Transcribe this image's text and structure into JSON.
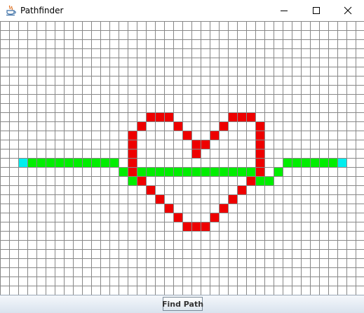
{
  "window": {
    "title": "Pathfinder",
    "icon": "java-cup-icon",
    "controls": [
      "minimize-icon",
      "maximize-icon",
      "close-icon"
    ]
  },
  "grid": {
    "columns": 40,
    "rows": 30,
    "colors": {
      "empty": "#ffffff",
      "line": "#888888",
      "wall": "#ee0000",
      "path": "#00ee00",
      "endpoint": "#00eeee"
    },
    "endpoint_cells": [
      [
        2,
        15
      ],
      [
        37,
        15
      ]
    ],
    "wall_cells": [
      [
        16,
        10
      ],
      [
        17,
        10
      ],
      [
        18,
        10
      ],
      [
        25,
        10
      ],
      [
        26,
        10
      ],
      [
        27,
        10
      ],
      [
        15,
        11
      ],
      [
        19,
        11
      ],
      [
        24,
        11
      ],
      [
        28,
        11
      ],
      [
        14,
        12
      ],
      [
        20,
        12
      ],
      [
        23,
        12
      ],
      [
        28,
        12
      ],
      [
        14,
        13
      ],
      [
        21,
        13
      ],
      [
        22,
        13
      ],
      [
        28,
        13
      ],
      [
        14,
        14
      ],
      [
        21,
        14
      ],
      [
        28,
        14
      ],
      [
        14,
        15
      ],
      [
        28,
        15
      ],
      [
        14,
        16
      ],
      [
        28,
        16
      ],
      [
        15,
        17
      ],
      [
        27,
        17
      ],
      [
        16,
        18
      ],
      [
        26,
        18
      ],
      [
        17,
        19
      ],
      [
        25,
        19
      ],
      [
        18,
        20
      ],
      [
        24,
        20
      ],
      [
        19,
        21
      ],
      [
        23,
        21
      ],
      [
        20,
        22
      ],
      [
        21,
        22
      ],
      [
        22,
        22
      ]
    ],
    "path_cells": [
      [
        3,
        15
      ],
      [
        4,
        15
      ],
      [
        5,
        15
      ],
      [
        6,
        15
      ],
      [
        7,
        15
      ],
      [
        8,
        15
      ],
      [
        9,
        15
      ],
      [
        10,
        15
      ],
      [
        11,
        15
      ],
      [
        12,
        15
      ],
      [
        13,
        16
      ],
      [
        14,
        17
      ],
      [
        15,
        16
      ],
      [
        16,
        16
      ],
      [
        17,
        16
      ],
      [
        18,
        16
      ],
      [
        19,
        16
      ],
      [
        20,
        16
      ],
      [
        21,
        16
      ],
      [
        22,
        16
      ],
      [
        23,
        16
      ],
      [
        24,
        16
      ],
      [
        25,
        16
      ],
      [
        26,
        16
      ],
      [
        27,
        16
      ],
      [
        28,
        17
      ],
      [
        29,
        17
      ],
      [
        30,
        16
      ],
      [
        31,
        15
      ],
      [
        32,
        15
      ],
      [
        33,
        15
      ],
      [
        34,
        15
      ],
      [
        35,
        15
      ],
      [
        36,
        15
      ]
    ]
  },
  "toolbar": {
    "find_path_label": "Find Path"
  }
}
